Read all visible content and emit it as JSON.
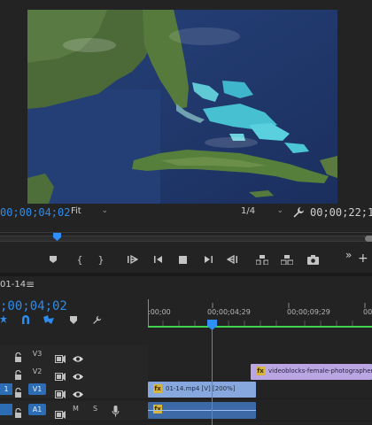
{
  "program_monitor": {
    "timecode_current": "00;00;04;02",
    "fit_option": "Fit",
    "resolution_option": "1/4",
    "timecode_duration": "00;00;22;11"
  },
  "transport": {
    "buttons": [
      "add-marker",
      "mark-in",
      "mark-out",
      "go-to-in",
      "step-back",
      "stop",
      "step-forward",
      "go-to-out",
      "lift",
      "extract",
      "export-frame"
    ],
    "more": "»",
    "add": "+"
  },
  "timeline": {
    "sequence_name": "01-14",
    "menu_icon": "≡",
    "timecode": ";00;04;02",
    "ruler_labels": [
      ":00;00",
      "00;00;04;29",
      "00;00;09;29",
      "00;00"
    ],
    "tracks": [
      {
        "name": "V3",
        "selected": false,
        "source": ""
      },
      {
        "name": "V2",
        "selected": false,
        "source": ""
      },
      {
        "name": "V1",
        "selected": true,
        "source": "1"
      },
      {
        "name": "A1",
        "selected": true,
        "source": ""
      },
      {
        "name": "",
        "selected": false,
        "source": ""
      }
    ],
    "audio_buttons": {
      "mute": "M",
      "solo": "S"
    },
    "clips": {
      "v2_label": "videoblocks-female-photographer-as",
      "v1_label": "01-14.mp4 [V] [200%]",
      "fx": "fx"
    }
  },
  "colors": {
    "timecode_blue": "#2d8ceb",
    "playhead": "#2f8fff",
    "work_area": "#3fd34f",
    "v2_clip": "#b9a6e3",
    "v1_clip": "#86a8de",
    "a1_clip": "#3d6aa6"
  }
}
